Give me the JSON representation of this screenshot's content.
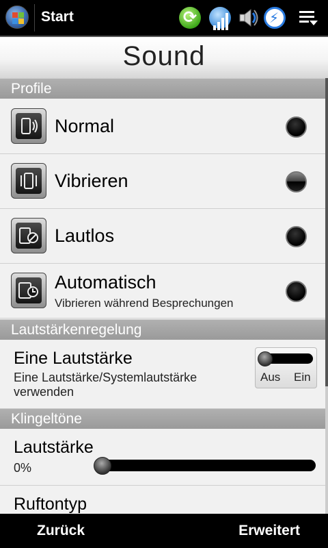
{
  "statusbar": {
    "title": "Start",
    "icons": [
      "windows-start-icon",
      "sync-icon",
      "signal-icon",
      "speaker-icon",
      "battery-bolt-icon",
      "menu-icon"
    ]
  },
  "header": {
    "title": "Sound"
  },
  "sections": {
    "profiles": "Profile",
    "volume_control": "Lautstärkenregelung",
    "ringtones": "Klingeltöne"
  },
  "profiles": [
    {
      "label": "Normal",
      "sublabel": "",
      "icon": "speaker-phone-icon",
      "selected": false
    },
    {
      "label": "Vibrieren",
      "sublabel": "",
      "icon": "vibrate-icon",
      "selected": true
    },
    {
      "label": "Lautlos",
      "sublabel": "",
      "icon": "silent-icon",
      "selected": false
    },
    {
      "label": "Automatisch",
      "sublabel": "Vibrieren während Besprechungen",
      "icon": "automatic-clock-icon",
      "selected": false
    }
  ],
  "single_volume": {
    "title": "Eine Lautstärke",
    "description": "Eine Lautstärke/Systemlautstärke verwenden",
    "off_label": "Aus",
    "on_label": "Ein",
    "enabled": false
  },
  "ring_volume": {
    "title": "Lautstärke",
    "value_text": "0%",
    "level": 0
  },
  "ring_tone": {
    "title": "Ruftontyp"
  },
  "softkeys": {
    "left": "Zurück",
    "right": "Erweitert"
  }
}
